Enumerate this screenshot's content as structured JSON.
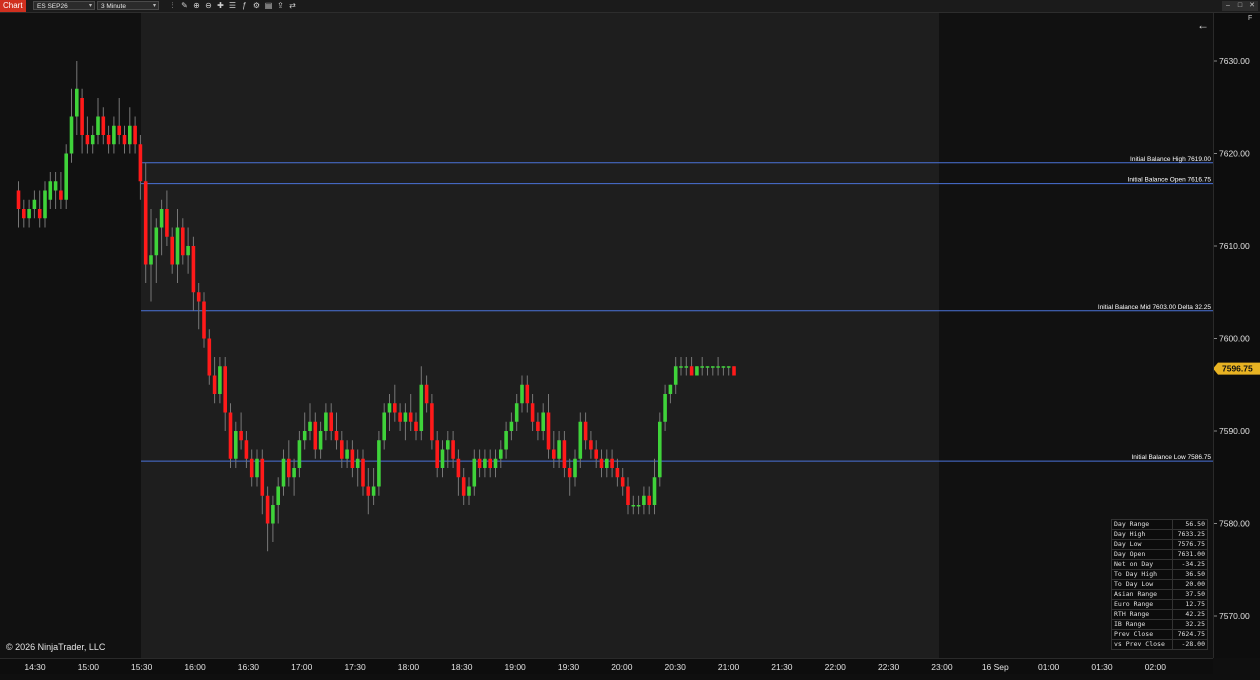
{
  "toolbar": {
    "chart_tab": "Chart",
    "instrument": "ES SEP26",
    "interval": "3 Minute",
    "icons": [
      "bar-type-icon",
      "draw-tools-icon",
      "zoom-in-icon",
      "zoom-out-icon",
      "crosshair-icon",
      "properties-icon",
      "indicators-icon",
      "strategies-icon",
      "data-box-icon",
      "share-icon",
      "order-panel-icon"
    ]
  },
  "window_controls": [
    "minimize-icon",
    "maximize-icon",
    "close-icon"
  ],
  "copyright": "© 2026 NinjaTrader, LLC",
  "price_axis": {
    "ticks": [
      "7630.00",
      "7620.00",
      "7610.00",
      "7600.00",
      "7590.00",
      "7580.00",
      "7570.00"
    ],
    "last_price": "7596.75",
    "last_price_color": "#e8b323"
  },
  "time_axis": [
    "14:30",
    "15:00",
    "15:30",
    "16:00",
    "16:30",
    "17:00",
    "17:30",
    "18:00",
    "18:30",
    "19:00",
    "19:30",
    "20:00",
    "20:30",
    "21:00",
    "21:30",
    "22:00",
    "22:30",
    "23:00",
    "16 Sep",
    "01:00",
    "01:30",
    "02:00"
  ],
  "levels": [
    {
      "label": "Initial Balance High 7619.00",
      "price": 7619.0
    },
    {
      "label": "Initial Balance Open 7616.75",
      "price": 7616.75
    },
    {
      "label": "Initial Balance Mid 7603.00   Delta 32.25",
      "price": 7603.0
    },
    {
      "label": "Initial Balance Low 7586.75",
      "price": 7586.75
    }
  ],
  "colors": {
    "up": "#3fd33a",
    "down": "#ff1a1a",
    "level": "#4a72d8",
    "session_bg": "#1e1e1e"
  },
  "stats": [
    {
      "label": "Day Range",
      "value": "56.50"
    },
    {
      "label": "Day High",
      "value": "7633.25"
    },
    {
      "label": "Day Low",
      "value": "7576.75"
    },
    {
      "label": "Day Open",
      "value": "7631.00"
    },
    {
      "label": "Net on Day",
      "value": "-34.25"
    },
    {
      "label": "To Day High",
      "value": "36.50"
    },
    {
      "label": "To Day Low",
      "value": "20.00"
    },
    {
      "label": "Asian Range",
      "value": "37.50"
    },
    {
      "label": "Euro Range",
      "value": "12.75"
    },
    {
      "label": "RTH Range",
      "value": "42.25"
    },
    {
      "label": "IB Range",
      "value": "32.25"
    },
    {
      "label": "Prev Close",
      "value": "7624.75"
    },
    {
      "label": "vs Prev Close",
      "value": "-28.00"
    }
  ],
  "chart_data": {
    "type": "candlestick",
    "ylim": [
      7567,
      7637
    ],
    "candles": [
      [
        7616,
        7617,
        7612,
        7614
      ],
      [
        7614,
        7615,
        7612,
        7613
      ],
      [
        7613,
        7615,
        7612,
        7614
      ],
      [
        7614,
        7616,
        7613,
        7615
      ],
      [
        7614,
        7616,
        7612,
        7613
      ],
      [
        7613,
        7617,
        7612,
        7616
      ],
      [
        7615,
        7618,
        7614,
        7617
      ],
      [
        7616,
        7618,
        7614,
        7617
      ],
      [
        7616,
        7618,
        7614,
        7615
      ],
      [
        7615,
        7621,
        7614,
        7620
      ],
      [
        7620,
        7627,
        7619,
        7624
      ],
      [
        7624,
        7630,
        7622,
        7627
      ],
      [
        7626,
        7627,
        7620,
        7622
      ],
      [
        7622,
        7624,
        7620,
        7621
      ],
      [
        7621,
        7623,
        7620,
        7622
      ],
      [
        7622,
        7626,
        7621,
        7624
      ],
      [
        7624,
        7625,
        7621,
        7622
      ],
      [
        7622,
        7623,
        7620,
        7621
      ],
      [
        7621,
        7624,
        7620,
        7623
      ],
      [
        7623,
        7626,
        7621,
        7622
      ],
      [
        7622,
        7623,
        7620,
        7621
      ],
      [
        7621,
        7625,
        7620,
        7623
      ],
      [
        7623,
        7624,
        7620,
        7621
      ],
      [
        7621,
        7622,
        7615,
        7617
      ],
      [
        7617,
        7619,
        7606,
        7608
      ],
      [
        7608,
        7614,
        7604,
        7609
      ],
      [
        7609,
        7613,
        7606,
        7612
      ],
      [
        7612,
        7615,
        7609,
        7614
      ],
      [
        7614,
        7616,
        7610,
        7611
      ],
      [
        7611,
        7612,
        7607,
        7608
      ],
      [
        7608,
        7614,
        7606,
        7612
      ],
      [
        7612,
        7613,
        7608,
        7609
      ],
      [
        7609,
        7612,
        7607,
        7610
      ],
      [
        7610,
        7611,
        7603,
        7605
      ],
      [
        7605,
        7606,
        7601,
        7604
      ],
      [
        7604,
        7605,
        7599,
        7600
      ],
      [
        7600,
        7601,
        7595,
        7596
      ],
      [
        7596,
        7598,
        7593,
        7594
      ],
      [
        7594,
        7598,
        7593,
        7597
      ],
      [
        7597,
        7598,
        7590,
        7592
      ],
      [
        7592,
        7593,
        7586,
        7587
      ],
      [
        7587,
        7591,
        7586,
        7590
      ],
      [
        7590,
        7592,
        7588,
        7589
      ],
      [
        7589,
        7590,
        7586,
        7587
      ],
      [
        7587,
        7588,
        7584,
        7585
      ],
      [
        7585,
        7588,
        7584,
        7587
      ],
      [
        7587,
        7588,
        7581,
        7583
      ],
      [
        7583,
        7584,
        7577,
        7580
      ],
      [
        7580,
        7583,
        7578,
        7582
      ],
      [
        7582,
        7585,
        7580,
        7584
      ],
      [
        7584,
        7588,
        7583,
        7587
      ],
      [
        7587,
        7589,
        7584,
        7585
      ],
      [
        7585,
        7587,
        7583,
        7586
      ],
      [
        7586,
        7590,
        7585,
        7589
      ],
      [
        7589,
        7592,
        7588,
        7590
      ],
      [
        7590,
        7593,
        7589,
        7591
      ],
      [
        7591,
        7592,
        7587,
        7588
      ],
      [
        7588,
        7591,
        7587,
        7590
      ],
      [
        7590,
        7593,
        7589,
        7592
      ],
      [
        7592,
        7593,
        7589,
        7590
      ],
      [
        7590,
        7592,
        7588,
        7589
      ],
      [
        7589,
        7590,
        7586,
        7587
      ],
      [
        7587,
        7589,
        7586,
        7588
      ],
      [
        7588,
        7589,
        7585,
        7586
      ],
      [
        7586,
        7588,
        7584,
        7587
      ],
      [
        7587,
        7588,
        7583,
        7584
      ],
      [
        7584,
        7586,
        7581,
        7583
      ],
      [
        7583,
        7586,
        7582,
        7584
      ],
      [
        7584,
        7590,
        7583,
        7589
      ],
      [
        7589,
        7593,
        7588,
        7592
      ],
      [
        7592,
        7594,
        7590,
        7593
      ],
      [
        7593,
        7595,
        7591,
        7592
      ],
      [
        7592,
        7593,
        7590,
        7591
      ],
      [
        7591,
        7593,
        7589,
        7592
      ],
      [
        7592,
        7594,
        7590,
        7591
      ],
      [
        7591,
        7592,
        7589,
        7590
      ],
      [
        7590,
        7597,
        7589,
        7595
      ],
      [
        7595,
        7596,
        7592,
        7593
      ],
      [
        7593,
        7594,
        7588,
        7589
      ],
      [
        7589,
        7590,
        7585,
        7586
      ],
      [
        7586,
        7589,
        7585,
        7588
      ],
      [
        7588,
        7590,
        7586,
        7589
      ],
      [
        7589,
        7590,
        7586,
        7587
      ],
      [
        7587,
        7588,
        7583,
        7585
      ],
      [
        7585,
        7586,
        7582,
        7583
      ],
      [
        7583,
        7585,
        7582,
        7584
      ],
      [
        7584,
        7588,
        7583,
        7587
      ],
      [
        7587,
        7588,
        7585,
        7586
      ],
      [
        7586,
        7588,
        7585,
        7587
      ],
      [
        7587,
        7588,
        7585,
        7586
      ],
      [
        7586,
        7588,
        7585,
        7587
      ],
      [
        7587,
        7589,
        7586,
        7588
      ],
      [
        7588,
        7591,
        7587,
        7590
      ],
      [
        7590,
        7592,
        7589,
        7591
      ],
      [
        7591,
        7594,
        7590,
        7593
      ],
      [
        7593,
        7596,
        7592,
        7595
      ],
      [
        7595,
        7596,
        7592,
        7593
      ],
      [
        7593,
        7594,
        7590,
        7591
      ],
      [
        7591,
        7592,
        7589,
        7590
      ],
      [
        7590,
        7593,
        7589,
        7592
      ],
      [
        7592,
        7594,
        7587,
        7588
      ],
      [
        7588,
        7590,
        7586,
        7587
      ],
      [
        7587,
        7590,
        7586,
        7589
      ],
      [
        7589,
        7590,
        7585,
        7586
      ],
      [
        7586,
        7587,
        7583,
        7585
      ],
      [
        7585,
        7588,
        7584,
        7587
      ],
      [
        7587,
        7592,
        7586,
        7591
      ],
      [
        7591,
        7592,
        7588,
        7589
      ],
      [
        7589,
        7590,
        7587,
        7588
      ],
      [
        7588,
        7589,
        7586,
        7587
      ],
      [
        7587,
        7588,
        7585,
        7586
      ],
      [
        7586,
        7588,
        7585,
        7587
      ],
      [
        7587,
        7588,
        7585,
        7586
      ],
      [
        7586,
        7587,
        7584,
        7585
      ],
      [
        7585,
        7586,
        7583,
        7584
      ],
      [
        7584,
        7585,
        7581,
        7582
      ],
      [
        7582,
        7583,
        7581,
        7582
      ],
      [
        7582,
        7583,
        7581,
        7582
      ],
      [
        7582,
        7584,
        7581,
        7583
      ],
      [
        7583,
        7584,
        7581,
        7582
      ],
      [
        7582,
        7587,
        7581,
        7585
      ],
      [
        7585,
        7592,
        7584,
        7591
      ],
      [
        7591,
        7595,
        7590,
        7594
      ],
      [
        7594,
        7595,
        7593,
        7595
      ],
      [
        7595,
        7598,
        7594,
        7597
      ],
      [
        7597,
        7598,
        7596,
        7597
      ],
      [
        7597,
        7598,
        7596,
        7597
      ],
      [
        7597,
        7598,
        7596,
        7596
      ],
      [
        7596,
        7597,
        7596,
        7597
      ],
      [
        7597,
        7598,
        7596,
        7597
      ],
      [
        7597,
        7597,
        7596,
        7597
      ],
      [
        7597,
        7597,
        7596,
        7597
      ],
      [
        7597,
        7598,
        7596,
        7597
      ],
      [
        7597,
        7597,
        7596,
        7597
      ],
      [
        7597,
        7597,
        7596,
        7597
      ],
      [
        7597,
        7597,
        7596,
        7596
      ]
    ]
  }
}
